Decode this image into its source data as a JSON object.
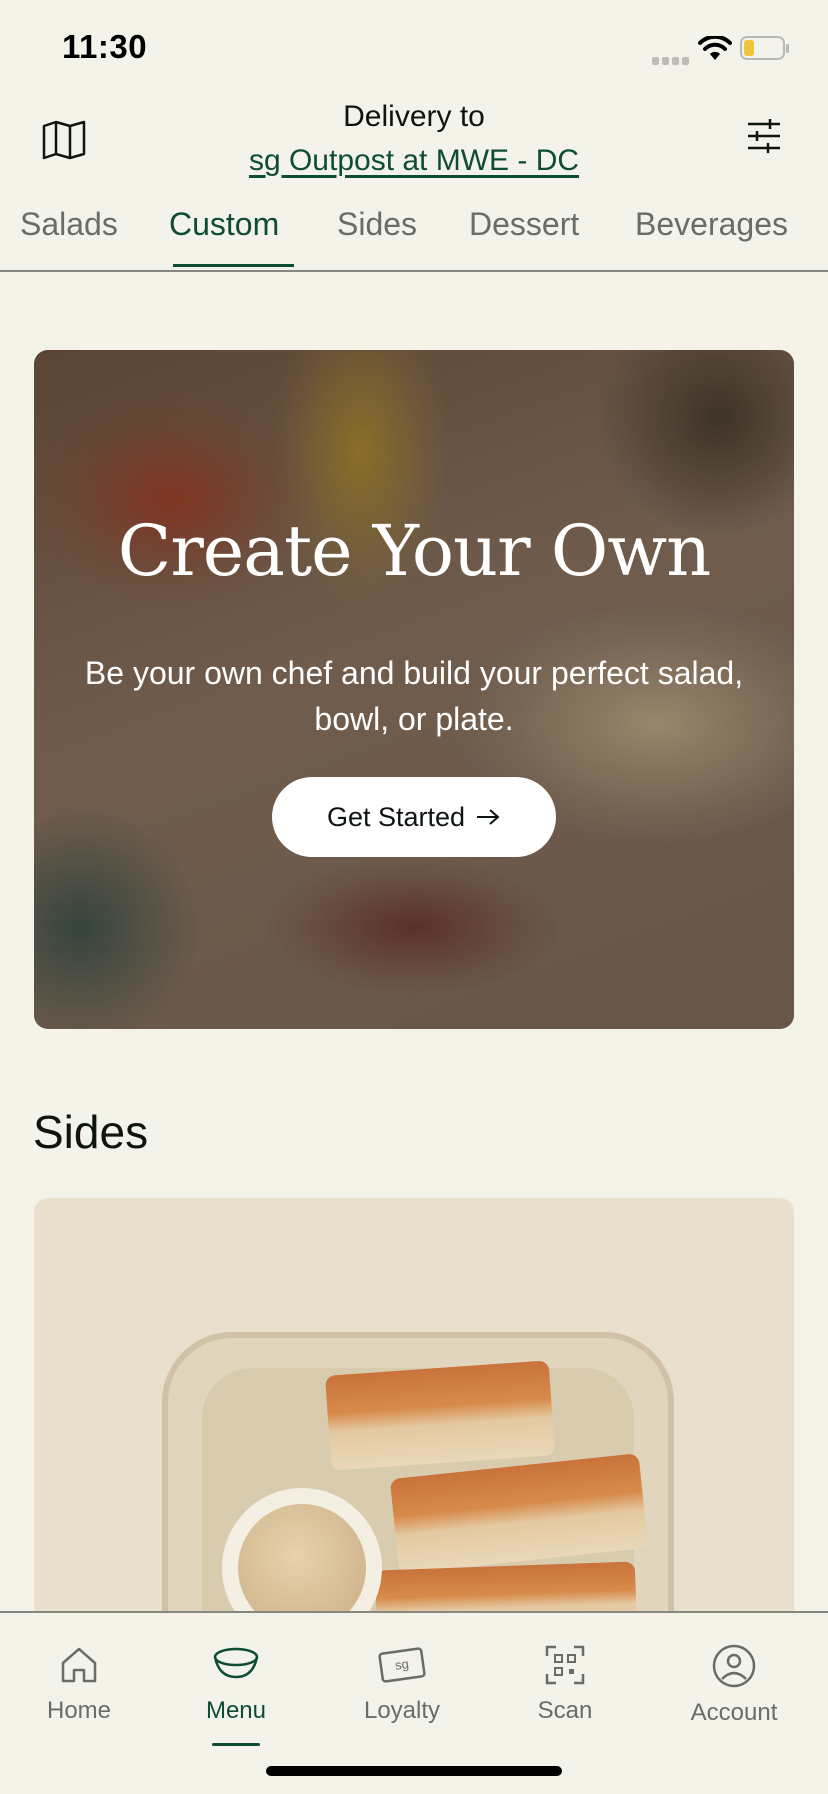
{
  "status_bar": {
    "time": "11:30"
  },
  "header": {
    "delivery_label": "Delivery to",
    "location": "sg Outpost at MWE - DC"
  },
  "tabs": [
    {
      "label": "Salads",
      "active": false
    },
    {
      "label": "Custom",
      "active": true
    },
    {
      "label": "Sides",
      "active": false
    },
    {
      "label": "Dessert",
      "active": false
    },
    {
      "label": "Beverages",
      "active": false
    }
  ],
  "hero": {
    "title": "Create Your Own",
    "subtitle": "Be your own chef and build your perfect salad, bowl, or plate.",
    "button_label": "Get Started"
  },
  "sides_section": {
    "title": "Sides"
  },
  "bottom_nav": [
    {
      "label": "Home",
      "icon": "home-icon",
      "active": false
    },
    {
      "label": "Menu",
      "icon": "bowl-icon",
      "active": true
    },
    {
      "label": "Loyalty",
      "icon": "sg-card-icon",
      "active": false
    },
    {
      "label": "Scan",
      "icon": "qr-scan-icon",
      "active": false
    },
    {
      "label": "Account",
      "icon": "user-icon",
      "active": false
    }
  ],
  "colors": {
    "background": "#F4F3EA",
    "accent": "#0E4D33",
    "inactive_text": "#6B6C66",
    "side_card_bg": "#E9DFCD"
  }
}
